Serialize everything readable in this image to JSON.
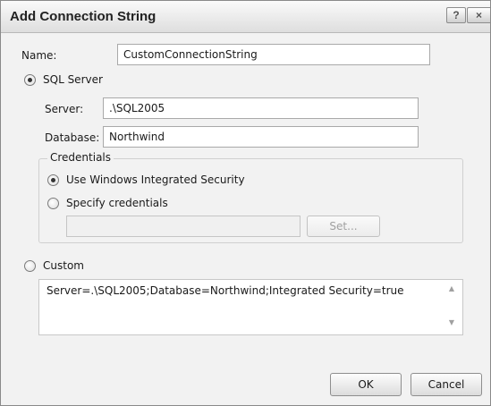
{
  "window": {
    "title": "Add Connection String",
    "help_glyph": "?",
    "close_glyph": "×"
  },
  "name_field": {
    "label": "Name:",
    "value": "CustomConnectionString"
  },
  "sql_server": {
    "label": "SQL Server",
    "selected": true,
    "server_label": "Server:",
    "server_value": ".\\SQL2005",
    "database_label": "Database:",
    "database_value": "Northwind"
  },
  "credentials": {
    "legend": "Credentials",
    "option_windows": "Use Windows Integrated Security",
    "option_specify": "Specify credentials",
    "selected": "windows",
    "credentials_value": "",
    "set_button": "Set..."
  },
  "custom": {
    "label": "Custom",
    "selected": false,
    "value": "Server=.\\SQL2005;Database=Northwind;Integrated Security=true",
    "scroll_up": "▲",
    "scroll_down": "▼"
  },
  "buttons": {
    "ok": "OK",
    "cancel": "Cancel"
  }
}
